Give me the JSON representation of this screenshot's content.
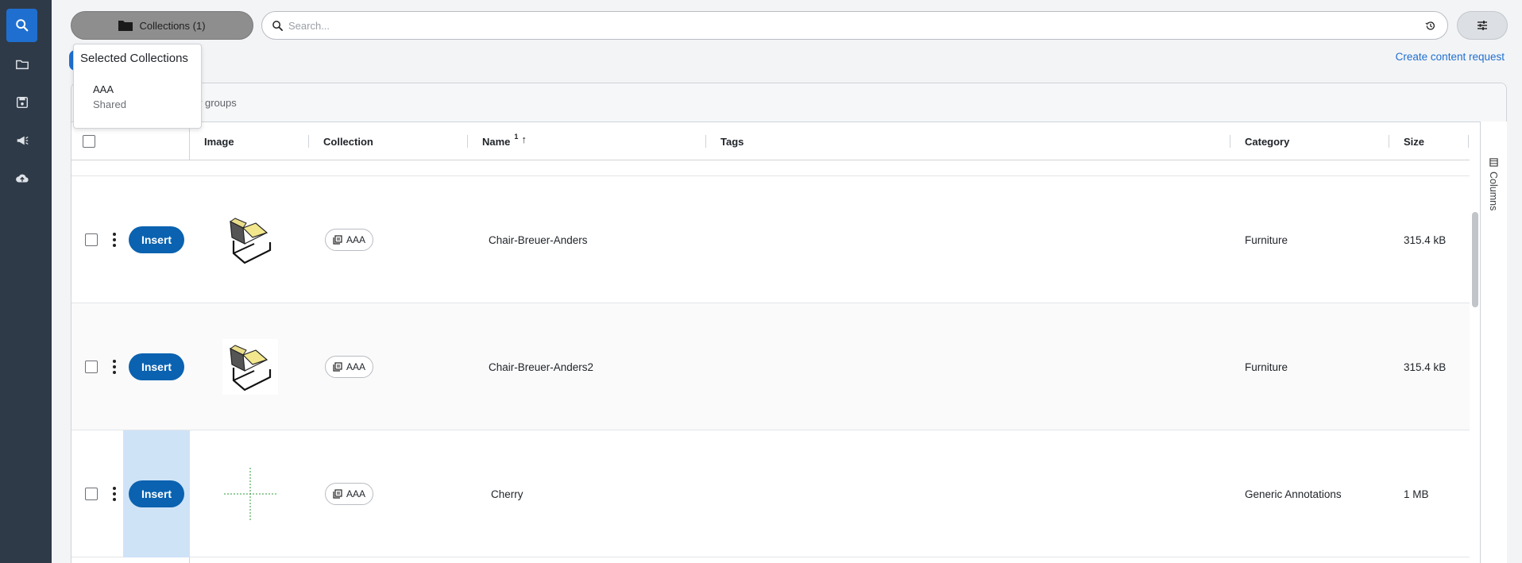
{
  "rail": {
    "items": [
      {
        "icon": "search-icon",
        "active": true
      },
      {
        "icon": "folder-icon",
        "active": false
      },
      {
        "icon": "save-icon",
        "active": false
      },
      {
        "icon": "megaphone-icon",
        "active": false
      },
      {
        "icon": "cloud-upload-icon",
        "active": false
      }
    ]
  },
  "toolbar": {
    "collections_label": "Collections (1)",
    "search_placeholder": "Search...",
    "create_request_label": "Create content request"
  },
  "groupbar": {
    "text": "w groups"
  },
  "popover": {
    "title": "Selected Collections",
    "item_name": "AAA",
    "item_sub": "Shared"
  },
  "table": {
    "columns": {
      "image": "Image",
      "collection": "Collection",
      "name": "Name",
      "name_sort_index": "1",
      "tags": "Tags",
      "category": "Category",
      "size": "Size"
    },
    "columns_tab_label": "Columns",
    "insert_label": "Insert",
    "rows": [
      {
        "collection": "AAA",
        "name": "Chair-Breuer-Anders",
        "tags": "",
        "category": "Furniture",
        "size": "315.4 kB",
        "thumb": "chair"
      },
      {
        "collection": "AAA",
        "name": "Chair-Breuer-Anders2",
        "tags": "",
        "category": "Furniture",
        "size": "315.4 kB",
        "thumb": "chair"
      },
      {
        "collection": "AAA",
        "name": "Cherry",
        "tags": "",
        "category": "Generic Annotations",
        "size": "1 MB",
        "thumb": "crosshair"
      }
    ]
  },
  "colors": {
    "accent": "#1f6fd0",
    "insert_button": "#0a62b0",
    "rail_bg": "#2f3a48",
    "row_highlight": "#cfe3f7"
  }
}
